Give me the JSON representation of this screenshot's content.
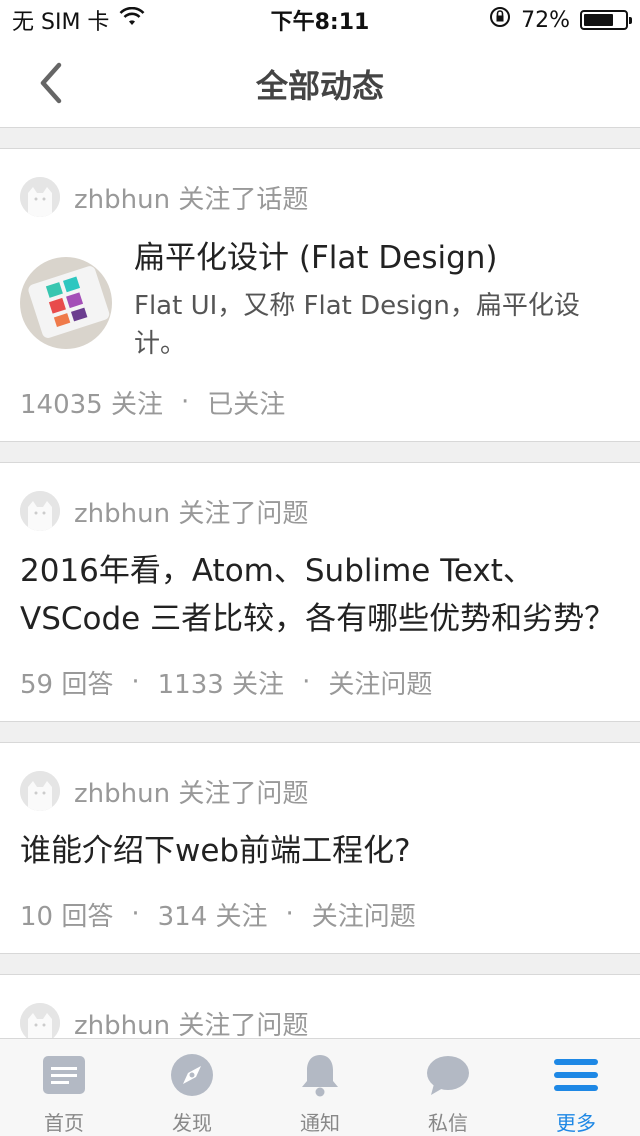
{
  "status_bar": {
    "carrier": "无 SIM 卡",
    "time": "下午8:11",
    "battery_text": "72%",
    "battery_level": 0.72
  },
  "nav": {
    "title": "全部动态"
  },
  "feed": [
    {
      "type": "topic",
      "actor": "zhbhun 关注了话题",
      "title": "扁平化设计 (Flat Design)",
      "desc": "Flat UI，又称 Flat Design，扁平化设计。",
      "meta": [
        "14035 关注",
        "已关注"
      ]
    },
    {
      "type": "question",
      "actor": "zhbhun 关注了问题",
      "title": "2016年看，Atom、Sublime Text、VSCode 三者比较，各有哪些优势和劣势？",
      "meta": [
        "59 回答",
        "1133 关注",
        "关注问题"
      ]
    },
    {
      "type": "question",
      "actor": "zhbhun 关注了问题",
      "title": "谁能介绍下web前端工程化?",
      "meta": [
        "10 回答",
        "314 关注",
        "关注问题"
      ]
    },
    {
      "type": "question",
      "actor": "zhbhun 关注了问题"
    }
  ],
  "tabs": [
    {
      "label": "首页",
      "icon": "home-icon"
    },
    {
      "label": "发现",
      "icon": "compass-icon"
    },
    {
      "label": "通知",
      "icon": "bell-icon"
    },
    {
      "label": "私信",
      "icon": "chat-icon"
    },
    {
      "label": "更多",
      "icon": "menu-icon"
    }
  ],
  "colors": {
    "accent": "#1e88e5",
    "muted": "#999999",
    "tab_icon": "#b3b9c4"
  }
}
